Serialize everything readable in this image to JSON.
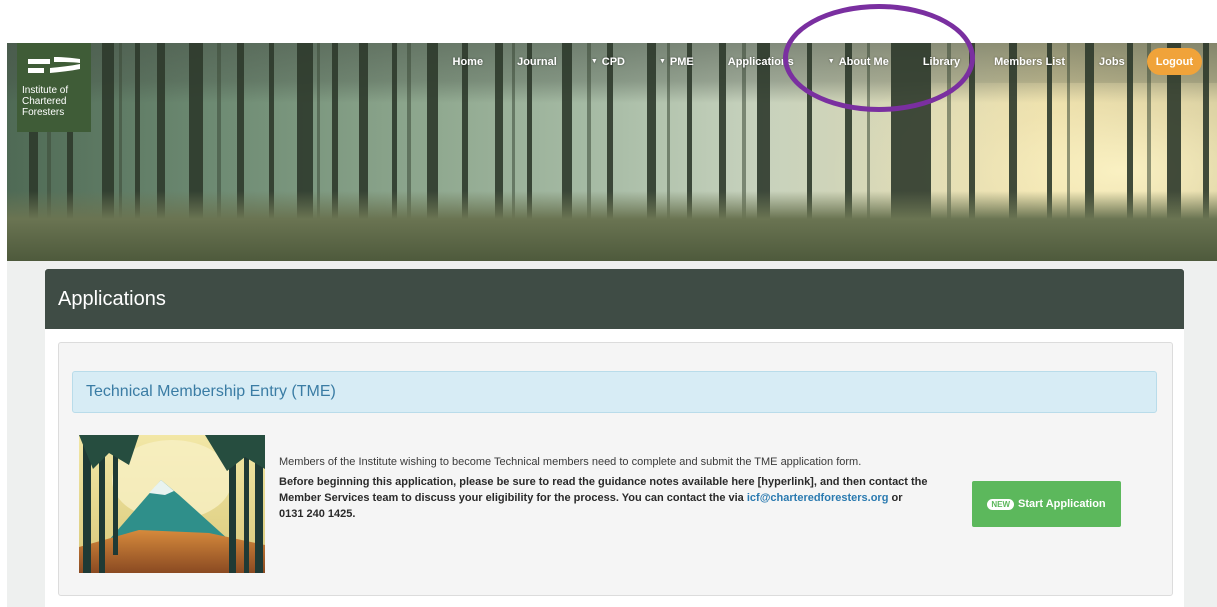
{
  "brand": {
    "logo_lines": [
      "Institute of",
      "Chartered",
      "Foresters"
    ]
  },
  "nav": {
    "items": [
      {
        "label": "Home",
        "dropdown": false
      },
      {
        "label": "Journal",
        "dropdown": false
      },
      {
        "label": "CPD",
        "dropdown": true
      },
      {
        "label": "PME",
        "dropdown": true
      },
      {
        "label": "Applications",
        "dropdown": false
      },
      {
        "label": "About Me",
        "dropdown": true
      },
      {
        "label": "Library",
        "dropdown": false
      },
      {
        "label": "Members List",
        "dropdown": false
      },
      {
        "label": "Jobs",
        "dropdown": false
      }
    ],
    "logout_label": "Logout"
  },
  "page": {
    "title": "Applications"
  },
  "section": {
    "title": "Technical Membership Entry (TME)",
    "intro": "Members of the Institute wishing to become Technical members need to complete and submit the TME application form.",
    "guidance_before": "Before beginning this application, please be sure to read the guidance notes available here [hyperlink], and then contact the Member Services team to discuss your eligibility for the process. You can contact the via ",
    "email": "icf@charteredforesters.org",
    "guidance_after": " or 0131 240 1425.",
    "badge": "NEW",
    "button_label": "Start Application"
  },
  "colors": {
    "logo_bg": "#3f5c37",
    "panel_header": "#3f4c45",
    "section_bar": "#d7ecf5",
    "section_text": "#3a7ca4",
    "link": "#2a7ab0",
    "start_button": "#5cb85c",
    "logout_button": "#f0a33a",
    "highlight_ring": "#7a2fa0"
  }
}
